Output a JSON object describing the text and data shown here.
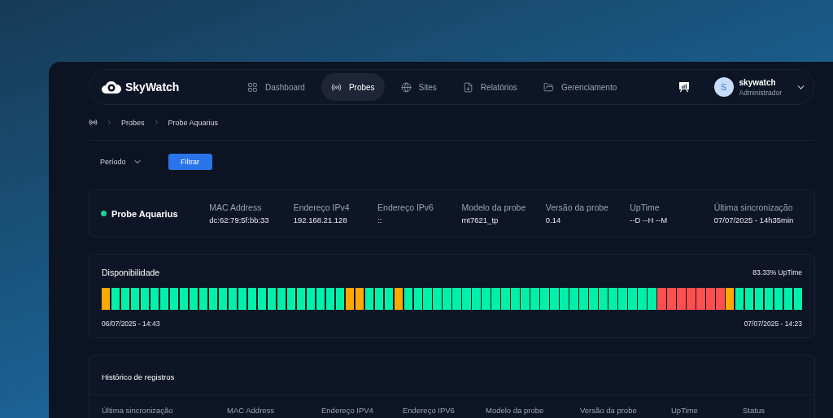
{
  "brand": {
    "name": "SkyWatch"
  },
  "nav": [
    {
      "label": "Dashboard",
      "selected": false
    },
    {
      "label": "Probes",
      "selected": true
    },
    {
      "label": "Sites",
      "selected": false
    },
    {
      "label": "Relatórios",
      "selected": false
    },
    {
      "label": "Gerenciamento",
      "selected": false
    }
  ],
  "user": {
    "initial": "S",
    "name": "skywatch",
    "role": "Administrador"
  },
  "breadcrumb": [
    "Probes",
    "Probe Aquarius"
  ],
  "filter": {
    "period_label": "Período",
    "button": "Filtrar"
  },
  "probe": {
    "name": "Probe Aquarius",
    "online": true,
    "fields": [
      {
        "label": "MAC Address",
        "value": "dc:62:79:5f:bb:33"
      },
      {
        "label": "Endereço IPv4",
        "value": "192.168.21.128"
      },
      {
        "label": "Endereço IPv6",
        "value": "::"
      },
      {
        "label": "Modelo da probe",
        "value": "mt7621_tp"
      },
      {
        "label": "Versão da probe",
        "value": "0.14"
      },
      {
        "label": "UpTime",
        "value": "--D --H --M"
      },
      {
        "label": "Última sincronização",
        "value": "07/07/2025 - 14h35min"
      }
    ]
  },
  "availability": {
    "title": "Disponibilidade",
    "uptime": "83.33% UpTime",
    "start": "06/07/2025 - 14:43",
    "end": "07/07/2025 - 14:23",
    "bars": [
      {
        "color": "#ffa800"
      },
      {
        "color": "#00f0a8"
      },
      {
        "color": "#00f0a8"
      },
      {
        "color": "#00f0a8"
      },
      {
        "color": "#00f0a8"
      },
      {
        "color": "#00f0a8"
      },
      {
        "color": "#00f0a8"
      },
      {
        "color": "#00f0a8"
      },
      {
        "color": "#00f0a8"
      },
      {
        "color": "#00f0a8"
      },
      {
        "color": "#00f0a8"
      },
      {
        "color": "#00f0a8"
      },
      {
        "color": "#00f0a8"
      },
      {
        "color": "#00f0a8"
      },
      {
        "color": "#00f0a8"
      },
      {
        "color": "#00f0a8"
      },
      {
        "color": "#00f0a8"
      },
      {
        "color": "#00f0a8"
      },
      {
        "color": "#00f0a8"
      },
      {
        "color": "#00f0a8"
      },
      {
        "color": "#00f0a8"
      },
      {
        "color": "#00f0a8"
      },
      {
        "color": "#00f0a8"
      },
      {
        "color": "#00f0a8"
      },
      {
        "color": "#00f0a8"
      },
      {
        "color": "#ffa800"
      },
      {
        "color": "#ffa800"
      },
      {
        "color": "#00f0a8"
      },
      {
        "color": "#00f0a8"
      },
      {
        "color": "#00f0a8"
      },
      {
        "color": "#ffa800"
      },
      {
        "color": "#00f0a8"
      },
      {
        "color": "#00f0a8"
      },
      {
        "color": "#00f0a8"
      },
      {
        "color": "#00f0a8"
      },
      {
        "color": "#00f0a8"
      },
      {
        "color": "#00f0a8"
      },
      {
        "color": "#00f0a8"
      },
      {
        "color": "#00f0a8"
      },
      {
        "color": "#00f0a8"
      },
      {
        "color": "#00f0a8"
      },
      {
        "color": "#00f0a8"
      },
      {
        "color": "#00f0a8"
      },
      {
        "color": "#00f0a8"
      },
      {
        "color": "#00f0a8"
      },
      {
        "color": "#00f0a8"
      },
      {
        "color": "#00f0a8"
      },
      {
        "color": "#00f0a8"
      },
      {
        "color": "#00f0a8"
      },
      {
        "color": "#00f0a8"
      },
      {
        "color": "#00f0a8"
      },
      {
        "color": "#00f0a8"
      },
      {
        "color": "#00f0a8"
      },
      {
        "color": "#00f0a8"
      },
      {
        "color": "#00f0a8"
      },
      {
        "color": "#00f0a8"
      },
      {
        "color": "#00f0a8"
      },
      {
        "color": "#ff4f4f"
      },
      {
        "color": "#ff4f4f"
      },
      {
        "color": "#ff4f4f"
      },
      {
        "color": "#ff4f4f"
      },
      {
        "color": "#ff4f4f"
      },
      {
        "color": "#ff4f4f"
      },
      {
        "color": "#ff4f4f"
      },
      {
        "color": "#ffa800"
      },
      {
        "color": "#00f0a8"
      },
      {
        "color": "#00f0a8"
      },
      {
        "color": "#00f0a8"
      },
      {
        "color": "#00f0a8"
      },
      {
        "color": "#00f0a8"
      },
      {
        "color": "#00f0a8"
      },
      {
        "color": "#00f0a8"
      }
    ]
  },
  "history": {
    "title": "Histórico de registros",
    "columns": [
      "Última sincronização",
      "MAC Address",
      "Endereço IPV4",
      "Endereço IPV6",
      "Modelo da probe",
      "Versão da probe",
      "UpTime",
      "Status"
    ]
  }
}
